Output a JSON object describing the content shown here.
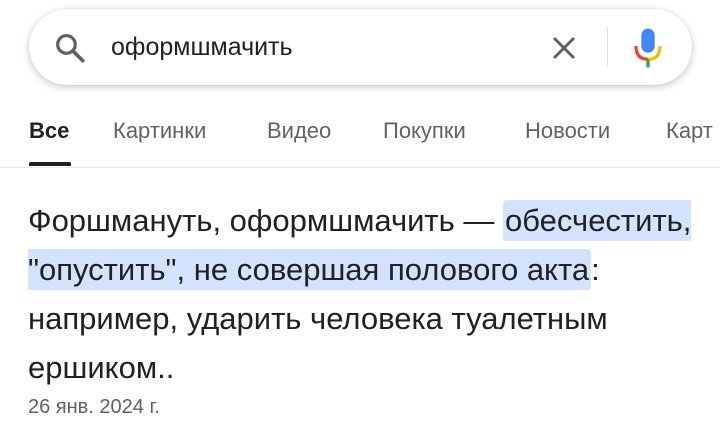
{
  "search": {
    "query": "оформшмачить"
  },
  "tabs": [
    {
      "label": "Все"
    },
    {
      "label": "Картинки"
    },
    {
      "label": "Видео"
    },
    {
      "label": "Покупки"
    },
    {
      "label": "Новости"
    },
    {
      "label": "Карт"
    }
  ],
  "result": {
    "text_before": "Форшмануть, оформшмачить — ",
    "highlight": "обесчестить, \"опустить\", не совершая полового акта",
    "text_after": ": например, ударить человека туалетным ершиком..",
    "date": "26 янв. 2024 г."
  },
  "colors": {
    "highlight": "#d3e3fd",
    "mic_blue": "#4285f4",
    "mic_red": "#ea4335",
    "mic_yellow": "#fbbc05",
    "mic_green": "#34a853"
  }
}
